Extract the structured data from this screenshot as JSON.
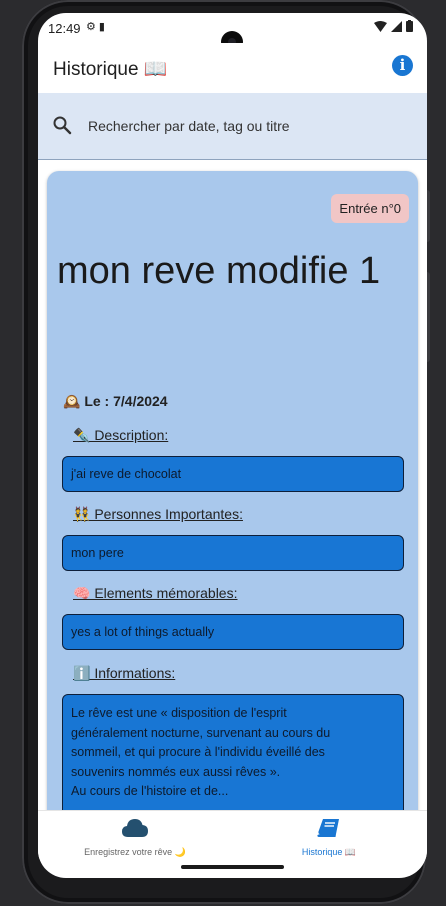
{
  "status": {
    "time": "12:49",
    "left_icons": "⚙ ▮",
    "right_icons": "▾◢▮"
  },
  "appbar": {
    "title": "Historique 📖",
    "info_icon": "info-icon"
  },
  "search": {
    "placeholder": "Rechercher par date, tag ou titre"
  },
  "entry": {
    "badge": "Entrée n°0",
    "title": "mon reve modifie 1",
    "date_line": "🕰️ Le : 7/4/2024",
    "description_label": "✒️ Description:",
    "description_value": "j'ai reve de chocolat",
    "people_label": "👯 Personnes Importantes:",
    "people_value": "mon pere",
    "elements_label": "🧠 Elements mémorables: ",
    "elements_value": "yes a lot of things actually",
    "info_label": "ℹ️ Informations:",
    "info_value": "Le rêve est une « disposition de l'esprit\ngénéralement nocturne, survenant au cours du\nsommeil, et qui procure à l'individu éveillé des\nsouvenirs nommés eux aussi rêves ».\nAu cours de l'histoire et de..."
  },
  "nav": {
    "items": [
      {
        "label": "Enregistrez votre rêve 🌙",
        "icon": "cloud-icon",
        "active": false
      },
      {
        "label": "Historique 📖",
        "icon": "book-icon",
        "active": true
      }
    ]
  },
  "colors": {
    "accent": "#1976d2",
    "card": "#a9c8ec",
    "field": "#1876d4",
    "badge": "#f1c6c6",
    "search_bg": "#dce6f4",
    "nav_inactive": "#24506f"
  }
}
